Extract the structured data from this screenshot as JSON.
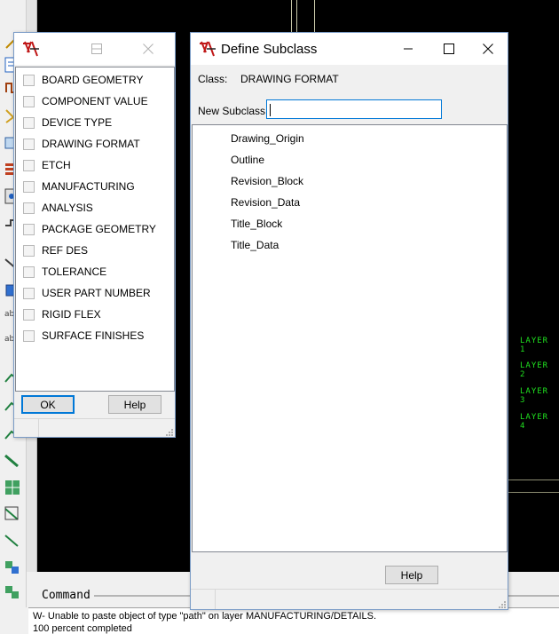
{
  "classes_window": {
    "items": [
      {
        "label": "BOARD GEOMETRY"
      },
      {
        "label": "COMPONENT VALUE"
      },
      {
        "label": "DEVICE TYPE"
      },
      {
        "label": "DRAWING FORMAT"
      },
      {
        "label": "ETCH"
      },
      {
        "label": "MANUFACTURING"
      },
      {
        "label": "ANALYSIS"
      },
      {
        "label": "PACKAGE GEOMETRY"
      },
      {
        "label": "REF DES"
      },
      {
        "label": "TOLERANCE"
      },
      {
        "label": "USER PART NUMBER"
      },
      {
        "label": "RIGID FLEX"
      },
      {
        "label": "SURFACE FINISHES"
      }
    ],
    "ok_label": "OK",
    "help_label": "Help"
  },
  "define_subclass": {
    "title": "Define Subclass",
    "class_label": "Class:",
    "class_value": "DRAWING FORMAT",
    "new_subclass_label": "New Subclass:",
    "new_subclass_value": "",
    "subclasses": [
      "Drawing_Origin",
      "Outline",
      "Revision_Block",
      "Revision_Data",
      "Title_Block",
      "Title_Data"
    ],
    "help_label": "Help"
  },
  "canvas": {
    "background": "#000000",
    "layer_labels": [
      "LAYER 1",
      "LAYER 2",
      "LAYER 3",
      "LAYER 4"
    ],
    "layer_label_color": "#20e020"
  },
  "command": {
    "label": "Command"
  },
  "status_messages": [
    "W- Unable to paste object of type \"path\" on layer MANUFACTURING/DETAILS.",
    "100 percent completed"
  ],
  "icons": {
    "app": "cadence-allegro-icon",
    "minimize": "minimize-icon",
    "maximize": "maximize-icon",
    "close": "close-icon",
    "size_grip": "size-grip-icon"
  },
  "colors": {
    "accent": "#0078d7",
    "window_border": "#7a9bc6"
  }
}
